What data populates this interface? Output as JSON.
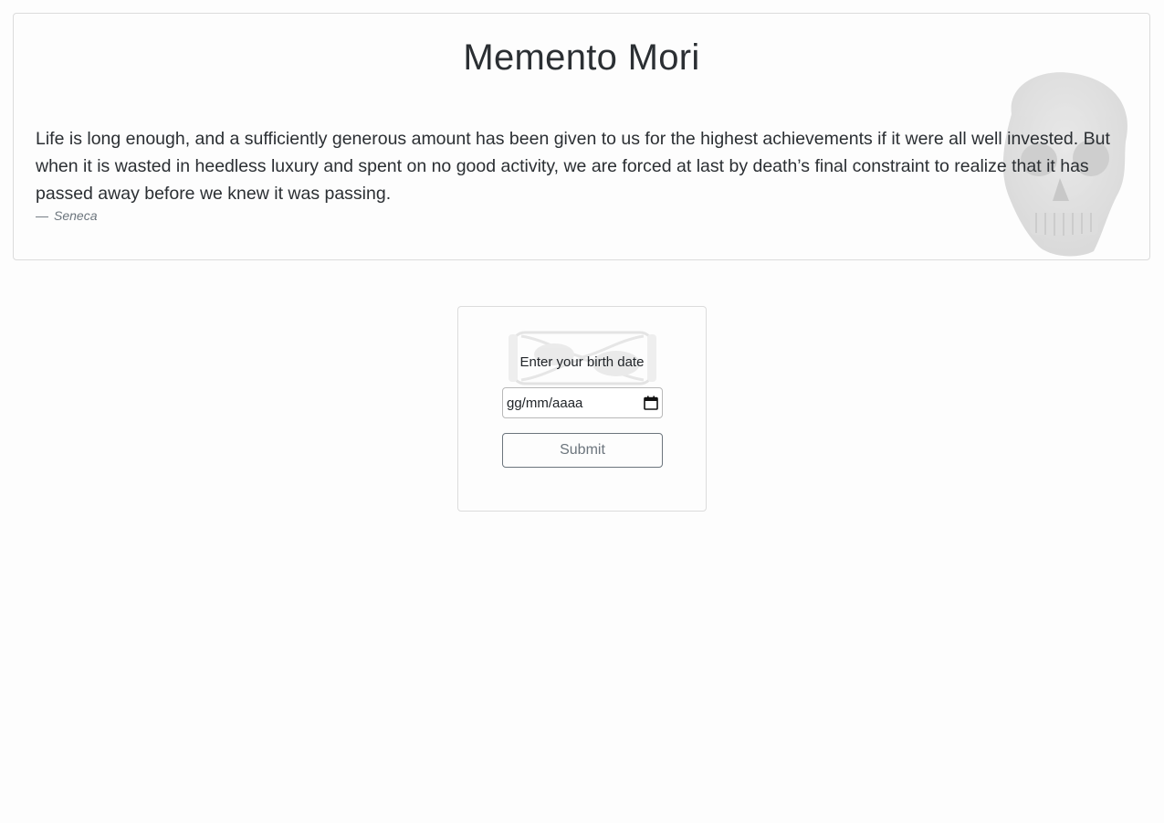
{
  "header": {
    "title": "Memento Mori"
  },
  "quote": {
    "text": "Life is long enough, and a sufficiently generous amount has been given to us for the highest achievements if it were all well invested. But when it is wasted in heedless luxury and spent on no good activity, we are forced at last by death’s final constraint to realize that it has passed away before we knew it was passing.",
    "dash": "—",
    "author": "Seneca",
    "background_icon": "skull-icon"
  },
  "form": {
    "label": "Enter your birth date",
    "date_placeholder": "gg/mm/aaaa",
    "submit_label": "Submit",
    "background_icon": "hourglass-icon"
  }
}
